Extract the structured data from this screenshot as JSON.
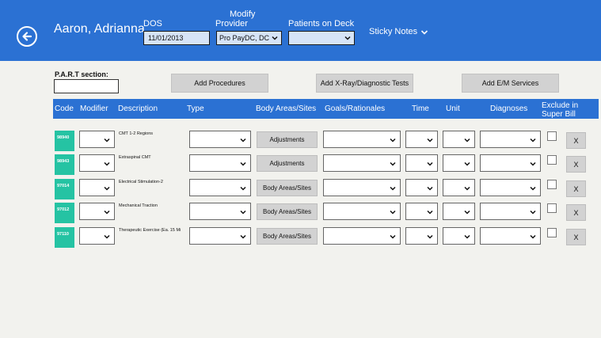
{
  "header": {
    "patient_name": "Aaron, Adrianna",
    "dos_label": "DOS",
    "dos_value": "11/01/2013",
    "modify_provider_label_1": "Modify",
    "modify_provider_label_2": "Provider",
    "provider_value": "Pro PayDC, DC",
    "patients_on_deck_label": "Patients on Deck",
    "patients_on_deck_value": "",
    "sticky_notes_label": "Sticky Notes"
  },
  "part_section": {
    "label": "P.A.R.T section:",
    "value": ""
  },
  "actions": {
    "add_procedures": "Add Procedures",
    "add_xray": "Add X-Ray/Diagnostic Tests",
    "add_em": "Add E/M Services"
  },
  "table": {
    "headers": {
      "code": "Code",
      "modifier": "Modifier",
      "description": "Description",
      "type": "Type",
      "body_areas": "Body Areas/Sites",
      "goals": "Goals/Rationales",
      "time": "Time",
      "unit": "Unit",
      "diagnoses": "Diagnoses",
      "exclude_1": "Exclude in",
      "exclude_2": "Super Bill"
    },
    "rows": [
      {
        "code": "98940",
        "description": "CMT 1-2 Regions",
        "body_button": "Adjustments",
        "remove": "X"
      },
      {
        "code": "98943",
        "description": "Extraspinal CMT",
        "body_button": "Adjustments",
        "remove": "X"
      },
      {
        "code": "97014",
        "description": "Electrical Stimulation-2",
        "body_button": "Body Areas/Sites",
        "remove": "X"
      },
      {
        "code": "97012",
        "description": "Mechanical Traction",
        "body_button": "Body Areas/Sites",
        "remove": "X"
      },
      {
        "code": "97110",
        "description": "Therapeutic Exercise (Ea. 15 Mi",
        "body_button": "Body Areas/Sites",
        "remove": "X"
      }
    ]
  },
  "colors": {
    "header_blue": "#2b71d3",
    "code_green": "#25c3a3",
    "background": "#f2f2ee"
  },
  "icons": {
    "back": "back-arrow-icon",
    "dropdown": "chevron-down-icon"
  }
}
